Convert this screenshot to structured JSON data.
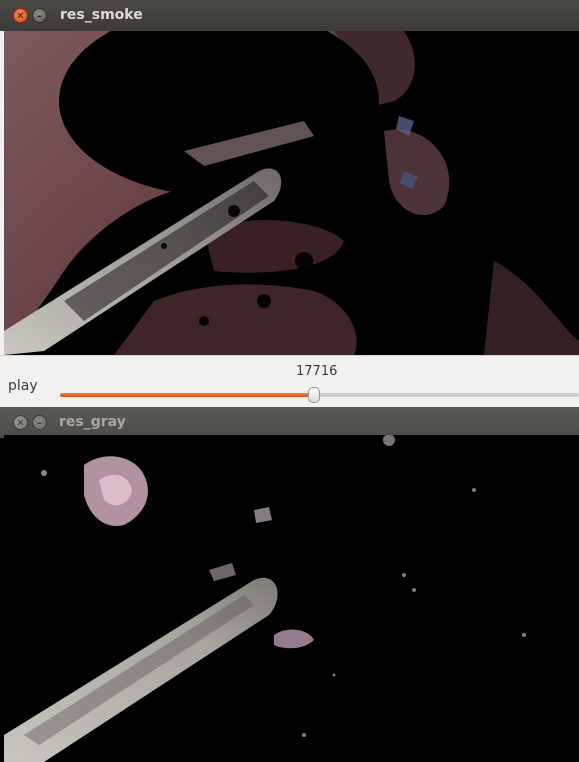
{
  "windows": {
    "smoke": {
      "title": "res_smoke",
      "close_glyph": "✕",
      "minimize_glyph": "–",
      "trackbar": {
        "name": "play",
        "value": "17716",
        "position": 0.49
      }
    },
    "gray": {
      "title": "res_gray",
      "close_glyph": "✕",
      "minimize_glyph": "–"
    }
  },
  "colors": {
    "accent": "#dd4d14",
    "close_button": "#df4a16",
    "titlebar": "#3c3b37",
    "panel": "#f2f1f0"
  },
  "icons": [
    "close-icon",
    "minimize-icon",
    "slider-handle"
  ]
}
